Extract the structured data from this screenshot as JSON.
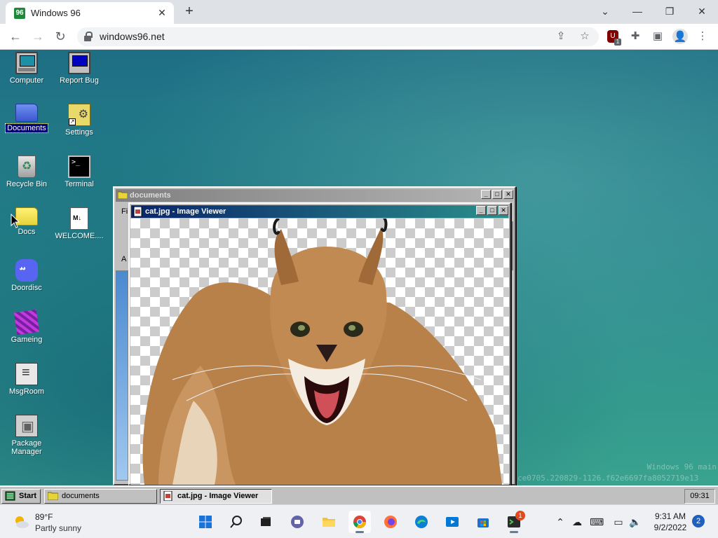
{
  "browser": {
    "tab_title": "Windows 96",
    "favicon_text": "96",
    "url": "windows96.net",
    "ublock_badge": "1"
  },
  "desktop": {
    "icons": [
      {
        "label": "Computer"
      },
      {
        "label": "Report Bug"
      },
      {
        "label": "Documents"
      },
      {
        "label": "Settings"
      },
      {
        "label": "Recycle Bin"
      },
      {
        "label": "Terminal"
      },
      {
        "label": "Docs"
      },
      {
        "label": "WELCOME...."
      },
      {
        "label": "Doordisc"
      },
      {
        "label": "Gameing"
      },
      {
        "label": "MsgRoom"
      },
      {
        "label": "Package Manager"
      }
    ],
    "build_title": "Windows 96 main",
    "build_hash": "ce0705.220829-1126.f62e6697fa8052719e13"
  },
  "windows": {
    "documents": {
      "title": "documents",
      "menu_fragment": "Fi",
      "addr_fragment": "A"
    },
    "image_viewer": {
      "title": "cat.jpg - Image Viewer"
    }
  },
  "w96_taskbar": {
    "start_label": "Start",
    "buttons": [
      {
        "label": "documents"
      },
      {
        "label": "cat.jpg - Image Viewer"
      }
    ],
    "clock": "09:31"
  },
  "win11_taskbar": {
    "weather_temp": "89°F",
    "weather_cond": "Partly sunny",
    "time": "9:31 AM",
    "date": "9/2/2022",
    "notification_count": "2",
    "teams_badge": "1"
  }
}
